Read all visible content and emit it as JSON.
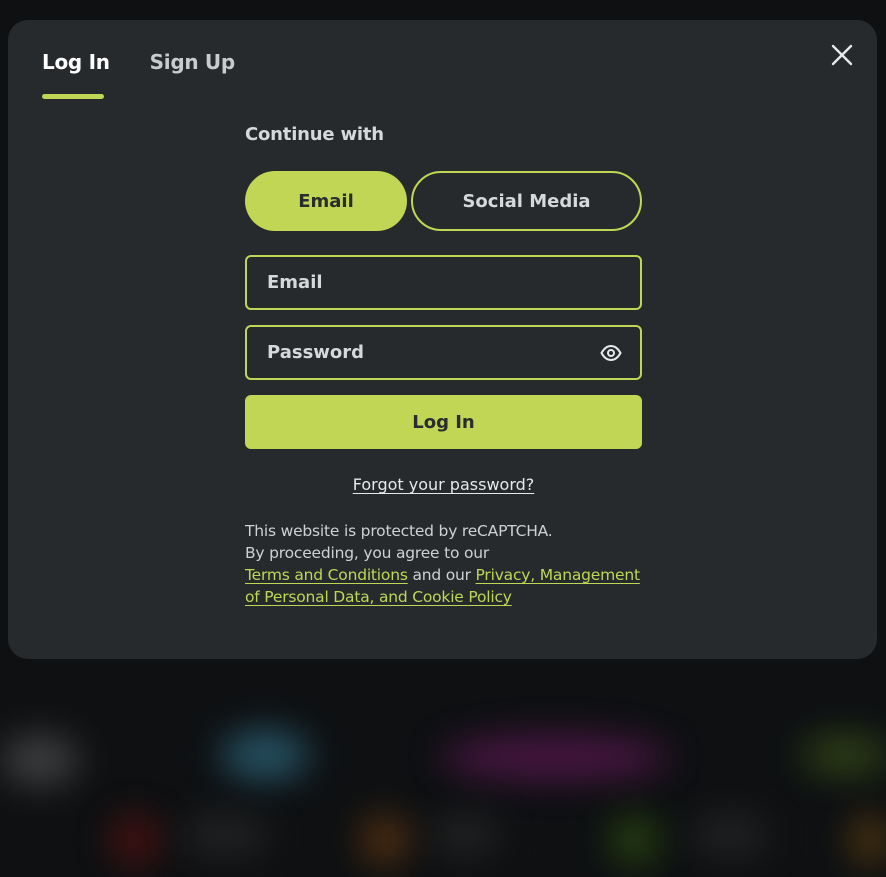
{
  "tabs": [
    {
      "label": "Log In",
      "active": true
    },
    {
      "label": "Sign Up",
      "active": false
    }
  ],
  "close_icon": "close-icon",
  "form": {
    "continue_label": "Continue with",
    "methods": {
      "email": "Email",
      "social": "Social Media"
    },
    "email_placeholder": "Email",
    "password_placeholder": "Password",
    "password_toggle_icon": "eye-icon",
    "login_button": "Log In",
    "forgot_link": "Forgot your password?",
    "legal": {
      "line1": "This website is protected by reCAPTCHA.",
      "line2": "By proceeding, you agree to our",
      "terms_link": "Terms and Conditions",
      "and_our": "and our",
      "privacy_link": "Privacy, Management of Personal Data, and Cookie Policy"
    }
  },
  "colors": {
    "accent": "#c0d654",
    "modal_bg": "#272a2d",
    "page_bg": "#0e1012"
  }
}
